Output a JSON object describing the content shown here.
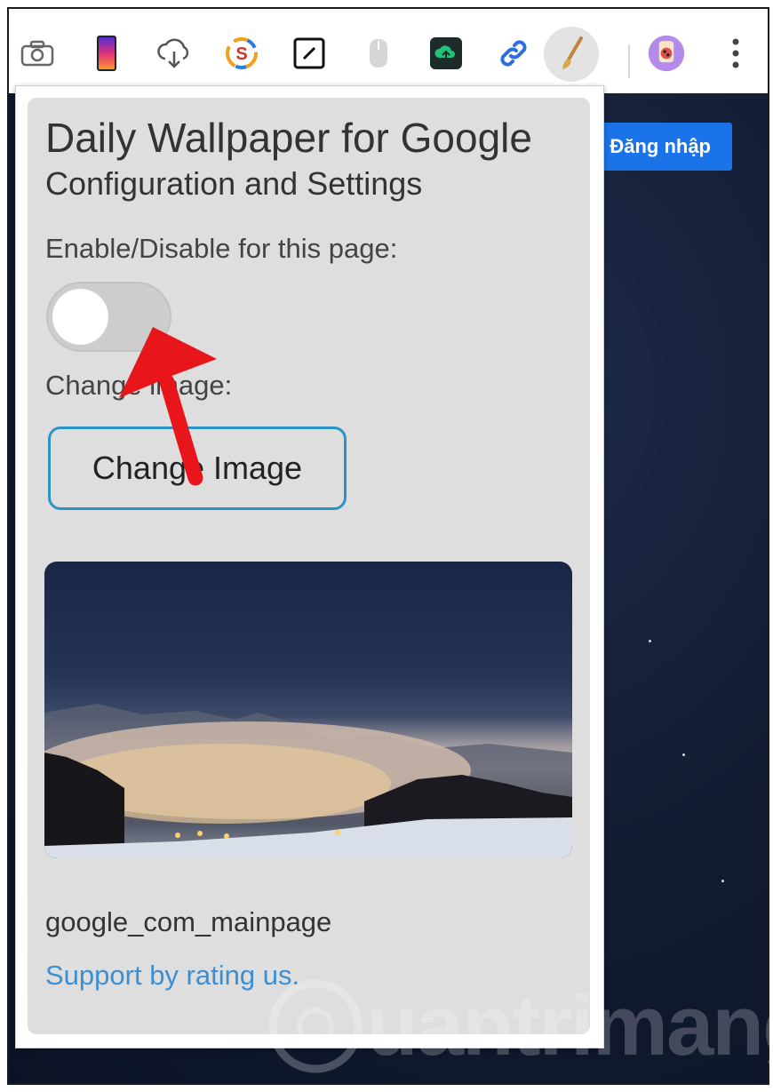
{
  "toolbar": {
    "icons": [
      "camera-icon",
      "phone-gradient-icon",
      "cloud-download-icon",
      "s-extension-icon",
      "edit-square-icon",
      "mouse-icon",
      "cloud-upload-green-icon",
      "link-icon",
      "paintbrush-icon",
      "avatar-extension-icon",
      "more-vert-icon"
    ]
  },
  "page": {
    "login_button": "Đăng nhập"
  },
  "popup": {
    "title": "Daily Wallpaper for Google",
    "subtitle": "Configuration and Settings",
    "toggle_label": "Enable/Disable for this page:",
    "toggle_state": "off",
    "change_label": "Change image:",
    "change_button": "Change Image",
    "filename": "google_com_mainpage",
    "support_link": "Support by rating us."
  },
  "watermark": "uantrimang",
  "colors": {
    "accent_blue": "#1a73e8",
    "button_border": "#2b94c6",
    "link": "#3d8fd1",
    "arrow": "#e8161b"
  }
}
